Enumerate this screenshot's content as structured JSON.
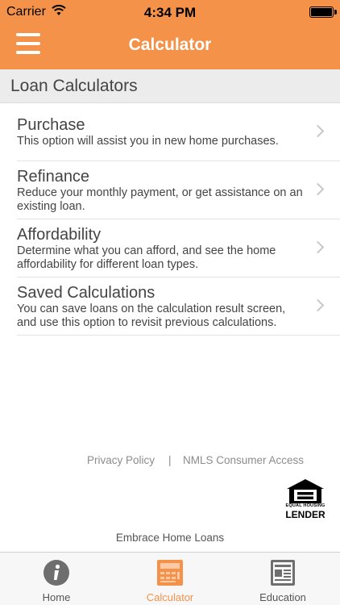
{
  "status_bar": {
    "carrier": "Carrier",
    "time": "4:34 PM",
    "battery_level": 1.0
  },
  "nav": {
    "title": "Calculator",
    "menu_icon": "hamburger-icon",
    "color": "#f4924a"
  },
  "section": {
    "title": "Loan Calculators"
  },
  "items": [
    {
      "title": "Purchase",
      "description": "This option will assist you in new home purchases."
    },
    {
      "title": "Refinance",
      "description": "Reduce your monthly payment, or get assistance on an existing loan."
    },
    {
      "title": "Affordability",
      "description": "Determine what you can afford, and see the home affordability for different loan types."
    },
    {
      "title": "Saved Calculations",
      "description": "You can save loans on the calculation result screen, and use this option to revisit previous calculations."
    }
  ],
  "footer": {
    "privacy": "Privacy Policy",
    "separator": "|",
    "nmls": "NMLS Consumer Access",
    "ehl_small": "EQUAL HOUSING",
    "ehl_big": "LENDER",
    "company": "Embrace Home Loans"
  },
  "tabs": [
    {
      "label": "Home",
      "icon": "info-icon"
    },
    {
      "label": "Calculator",
      "icon": "calculator-icon",
      "active": true
    },
    {
      "label": "Education",
      "icon": "newspaper-icon"
    }
  ],
  "colors": {
    "accent": "#f4924a",
    "icon_gray": "#6e6e6e"
  }
}
